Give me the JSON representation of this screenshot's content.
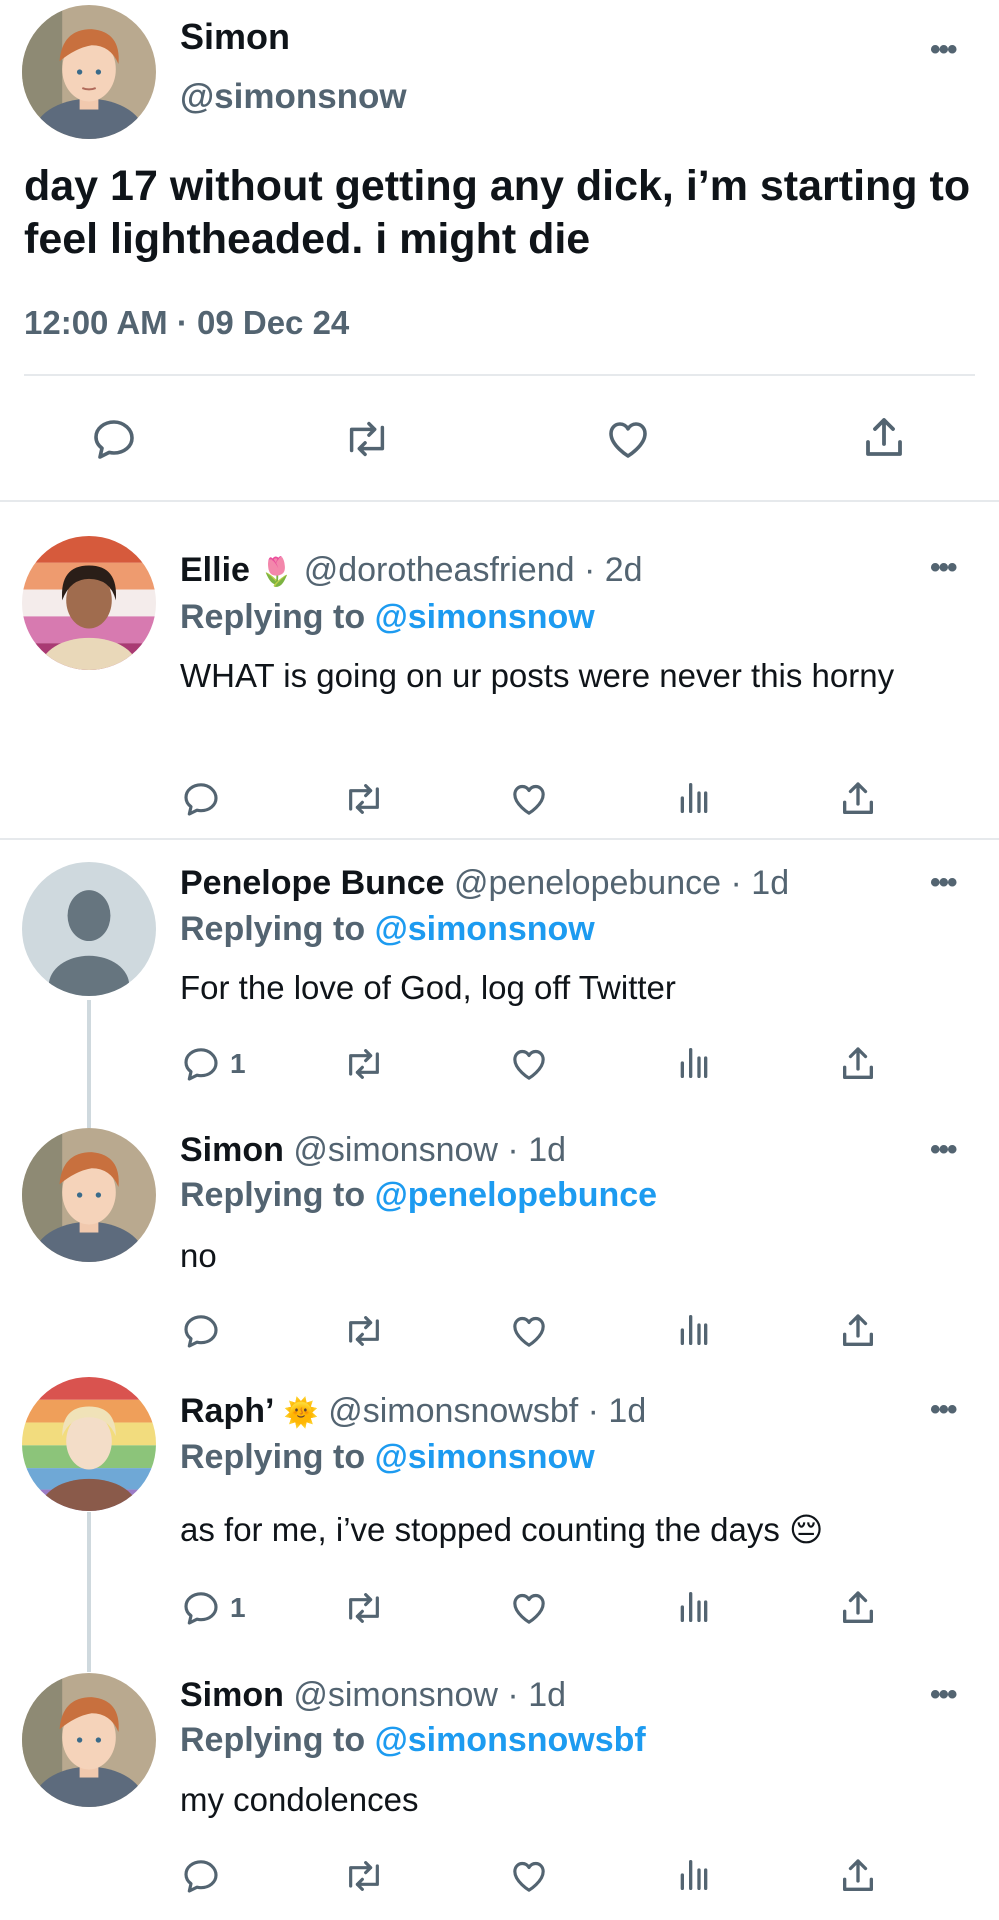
{
  "main_tweet": {
    "name": "Simon",
    "handle": "@simonsnow",
    "text": "day 17 without getting any dick, i’m starting to feel lightheaded. i might die",
    "timestamp": "12:00 AM · 09 Dec 24",
    "more": "•••"
  },
  "replies": [
    {
      "name": "Ellie",
      "emoji": "🌷",
      "handle": "@dorotheasfriend",
      "time": "2d",
      "replying_label": "Replying to",
      "replying_to": "@simonsnow",
      "text": "WHAT is going on ur posts were never this horny",
      "reply_count": "",
      "more": "•••"
    },
    {
      "name": "Penelope Bunce",
      "emoji": "",
      "handle": "@penelopebunce",
      "time": "1d",
      "replying_label": "Replying to",
      "replying_to": "@simonsnow",
      "text": "For the love of God, log off Twitter",
      "reply_count": "1",
      "more": "•••"
    },
    {
      "name": "Simon",
      "emoji": "",
      "handle": "@simonsnow",
      "time": "1d",
      "replying_label": "Replying to",
      "replying_to": "@penelopebunce",
      "text": "no",
      "reply_count": "",
      "more": "•••"
    },
    {
      "name": "Raph’",
      "emoji": "🌞",
      "handle": "@simonsnowsbf",
      "time": "1d",
      "replying_label": "Replying to",
      "replying_to": "@simonsnow",
      "text": "as for me, i’ve stopped counting the days 😔",
      "reply_count": "1",
      "more": "•••"
    },
    {
      "name": "Simon",
      "emoji": "",
      "handle": "@simonsnow",
      "time": "1d",
      "replying_label": "Replying to",
      "replying_to": "@simonsnowsbf",
      "text": "my condolences",
      "reply_count": "",
      "more": "•••"
    }
  ],
  "separator": "·",
  "icons": [
    "reply-icon",
    "retweet-icon",
    "like-icon",
    "views-icon",
    "share-icon",
    "more-icon"
  ],
  "colors": {
    "link": "#1d9bf0",
    "muted": "#536471",
    "text": "#0f1419",
    "divider": "#e6e9ec"
  }
}
